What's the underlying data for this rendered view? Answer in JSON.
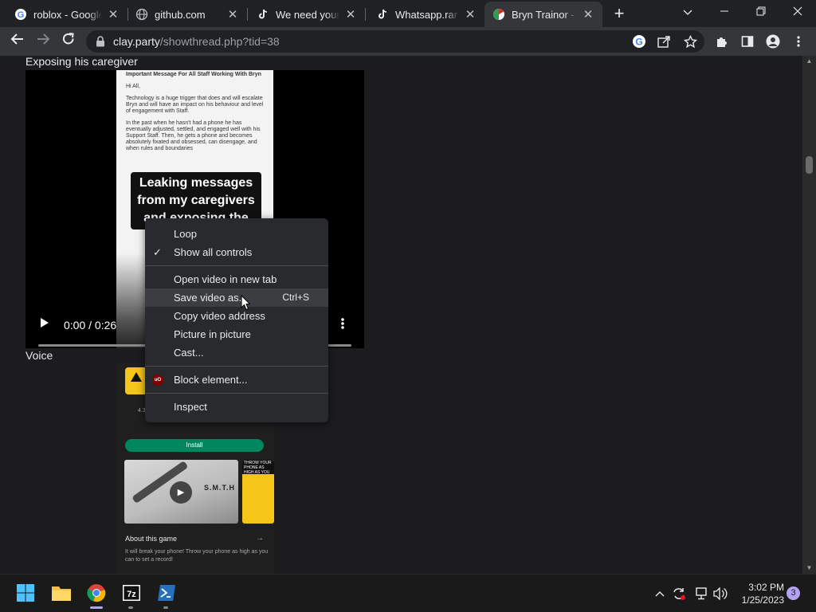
{
  "browser": {
    "tabs": [
      {
        "title": "roblox - Google",
        "favicon": "google-icon"
      },
      {
        "title": "github.com",
        "favicon": "globe-icon"
      },
      {
        "title": "We need your h",
        "favicon": "tiktok-icon"
      },
      {
        "title": "Whatsapp.rar - ",
        "favicon": "tiktok-icon"
      },
      {
        "title": "Bryn Trainor - B",
        "favicon": "clay-icon",
        "active": true
      }
    ],
    "url": {
      "domain": "clay.party",
      "path": "/showthread.php?tid=38"
    }
  },
  "page": {
    "section1_title": "Exposing his caregiver",
    "video": {
      "doc_heading": "Important Message For All Staff Working With Bryn",
      "doc_paragraphs": [
        "Hi All,",
        "Technology is a huge trigger that does and will escalate Bryn and will have an impact on his behaviour and level of engagement with Staff.",
        "In the past when he hasn't had a phone he has eventually adjusted, settled, and engaged well with his Support Staff. Then, he gets a phone and becomes absolutely fixated and obsessed, can disengage, and when rules and boundaries"
      ],
      "caption": "Leaking messages from my caregivers and exposing the",
      "time": "0:00 / 0:26"
    },
    "section2_title": "Voice",
    "store_card": {
      "rating": "4.3",
      "install_label": "Install",
      "shot_text": "S.M.T.H",
      "shot2_text": "THROW YOUR PHONE AS HIGH AS YOU",
      "about_title": "About this game",
      "about_desc": "It will break your phone! Throw your phone as high as you can to set a record!"
    }
  },
  "context_menu": {
    "items": [
      {
        "label": "Loop"
      },
      {
        "label": "Show all controls",
        "checked": true
      },
      {
        "label": "Open video in new tab"
      },
      {
        "label": "Save video as...",
        "shortcut": "Ctrl+S",
        "hover": true
      },
      {
        "label": "Copy video address"
      },
      {
        "label": "Picture in picture"
      },
      {
        "label": "Cast..."
      },
      {
        "label": "Block element..."
      },
      {
        "label": "Inspect"
      }
    ],
    "ublock_badge": "uO"
  },
  "taskbar": {
    "time": "3:02 PM",
    "date": "1/25/2023",
    "notifications": "3",
    "apps": [
      "windows-start-icon",
      "file-explorer-icon",
      "chrome-icon",
      "7zip-icon",
      "powershell-icon"
    ]
  },
  "colors": {
    "accent": "#8ab4f8",
    "background": "#202124",
    "menu": "#292a2d"
  }
}
